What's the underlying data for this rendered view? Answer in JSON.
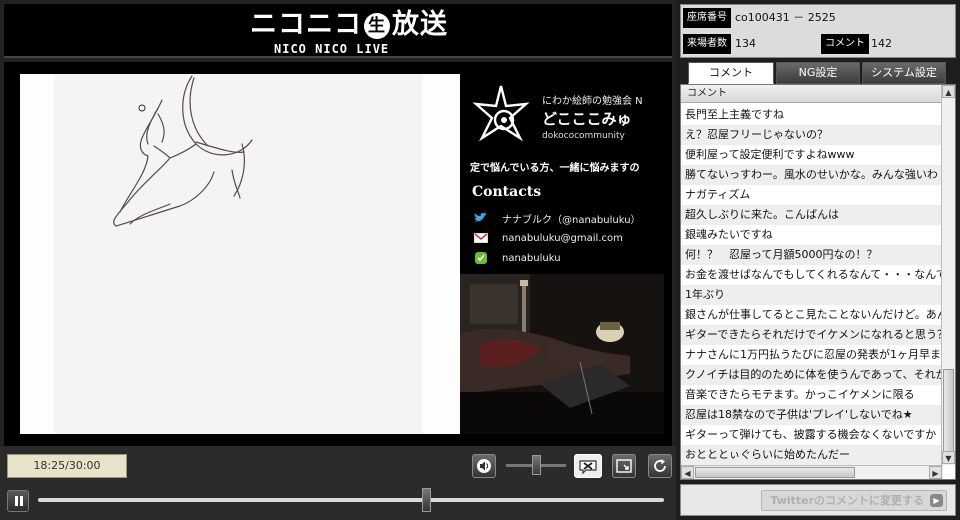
{
  "logo": {
    "main": "ニコニコ",
    "nama": "生",
    "main2": "放送",
    "sub": "NICO NICO LIVE"
  },
  "stream": {
    "community_title": "にわか絵師の勉強会 N",
    "community_name": "どこここみゅ",
    "community_id": "dokococommunity",
    "marquee": "定で悩んでいる方、一緒に悩みますの",
    "contacts_heading": "Contacts",
    "contacts": [
      {
        "icon": "twitter-icon",
        "text": "ナナブルク（@nanabuluku）"
      },
      {
        "icon": "gmail-icon",
        "text": "nanabuluku@gmail.com"
      },
      {
        "icon": "line-icon",
        "text": "nanabuluku"
      }
    ]
  },
  "player": {
    "time": "18:25/30:00",
    "volume_level": 0.5,
    "seek_position": 0.62
  },
  "stats": {
    "seat_label": "座席番号",
    "seat_value": "co100431 － 2525",
    "visitors_label": "来場者数",
    "visitors_value": "134",
    "comments_label": "コメント",
    "comments_value": "142"
  },
  "tabs": [
    "コメント",
    "NG設定",
    "システム設定"
  ],
  "comment_header": "コメント",
  "comments": [
    "長門至上主義ですね",
    "え？忍屋フリーじゃないの？",
    "便利屋って設定便利ですよねwww",
    "勝てないっすわー。風水のせいかな。みんな強いわ",
    "ナガティズム",
    "超久しぶりに来た。こんばんは",
    "銀魂みたいですね",
    "何！？　忍屋って月額5000円なの！？",
    "お金を渡せばなんでもしてくれるなんて・・・なんてエ",
    "1年ぶり",
    "銀さんが仕事してるとこ見たことないんだけど。あん",
    "ギターできたらそれだけでイケメンになれると思う？",
    "ナナさんに1万円払うたびに忍屋の発表が1ヶ月早ま",
    "クノイチは目的のために体を使うんであって、それか",
    "音楽できたらモテます。かっこイケメンに限る",
    "忍屋は18禁なので子供は'プレイ'しないでね★",
    "ギターって弾けても、披露する機会なくないですか",
    "おとととぃぐらいに始めたんだー"
  ],
  "twitter_button": "Twitterのコメントに変更する"
}
